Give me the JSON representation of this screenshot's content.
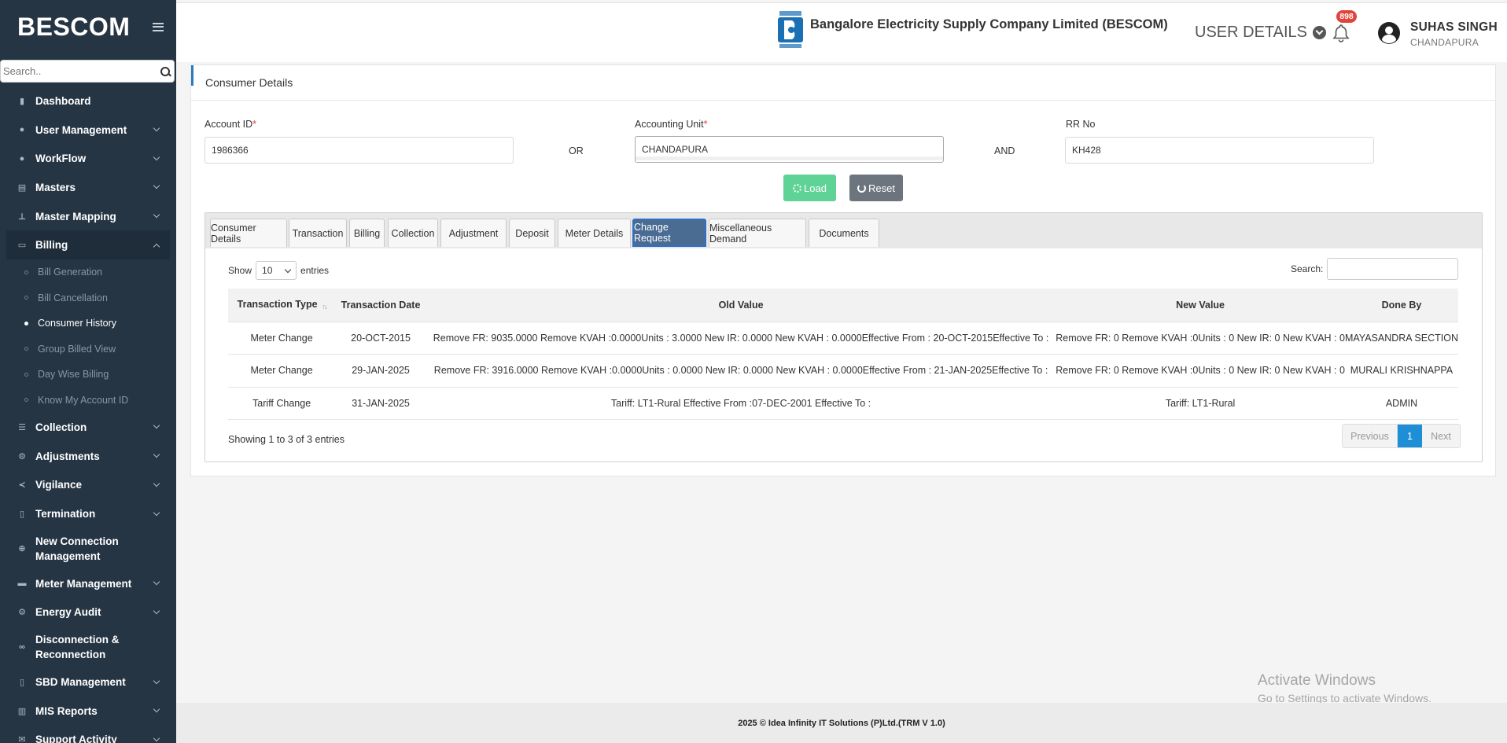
{
  "sidebar": {
    "brand": "BESCOM",
    "search_placeholder": "Search..",
    "items": [
      {
        "label": "Dashboard",
        "icon": "dashboard-icon",
        "glyph": "▮"
      },
      {
        "label": "User Management",
        "icon": "user-icon",
        "glyph": "●"
      },
      {
        "label": "WorkFlow",
        "icon": "workflow-icon",
        "glyph": "●"
      },
      {
        "label": "Masters",
        "icon": "masters-icon",
        "glyph": "▤"
      },
      {
        "label": "Master Mapping",
        "icon": "sitemap-icon",
        "glyph": "⊥"
      },
      {
        "label": "Billing",
        "icon": "monitor-icon",
        "glyph": "▭"
      }
    ],
    "billing_sub": [
      "Bill Generation",
      "Bill Cancellation",
      "Consumer History",
      "Group Billed View",
      "Day Wise Billing",
      "Know My Account ID"
    ],
    "items2": [
      {
        "label": "Collection",
        "icon": "list-icon",
        "glyph": "☰"
      },
      {
        "label": "Adjustments",
        "icon": "adjust-icon",
        "glyph": "⚙"
      },
      {
        "label": "Vigilance",
        "icon": "vk-icon",
        "glyph": "≺"
      },
      {
        "label": "Termination",
        "icon": "trash-icon",
        "glyph": "▯"
      },
      {
        "label": "New Connection Management",
        "icon": "plus-circle-icon",
        "glyph": "⊕"
      },
      {
        "label": "Meter Management",
        "icon": "meter-icon",
        "glyph": "▬"
      },
      {
        "label": "Energy Audit",
        "icon": "cogs-icon",
        "glyph": "⚙"
      },
      {
        "label": "Disconnection & Reconnection",
        "icon": "link-icon",
        "glyph": "∞"
      },
      {
        "label": "SBD Management",
        "icon": "mobile-icon",
        "glyph": "▯"
      },
      {
        "label": "MIS Reports",
        "icon": "bar-chart-icon",
        "glyph": "▥"
      },
      {
        "label": "Support Activity",
        "icon": "support-icon",
        "glyph": "✉"
      }
    ]
  },
  "header": {
    "company": "Bangalore Electricity Supply Company Limited (BESCOM)",
    "user_details": "USER DETAILS",
    "notifications": "898",
    "user_name": "SUHAS SINGH",
    "user_location": "CHANDAPURA"
  },
  "form": {
    "title": "Consumer Details",
    "account_label": "Account ID",
    "account_value": "1986366",
    "or": "OR",
    "unit_label": "Accounting Unit",
    "unit_value": "CHANDAPURA",
    "and": "AND",
    "rr_label": "RR No",
    "rr_value": "KH428",
    "required_mark": "*",
    "load": "Load",
    "reset": "Reset"
  },
  "tabs": [
    "Consumer Details",
    "Transaction",
    "Billing",
    "Collection",
    "Adjustment",
    "Deposit",
    "Meter Details",
    "Change Request",
    "Miscellaneous Demand",
    "Documents"
  ],
  "table": {
    "show": "Show",
    "page_length": "10",
    "entries": "entries",
    "search_label": "Search:",
    "columns": [
      "Transaction Type",
      "Transaction Date",
      "Old Value",
      "New Value",
      "Done By"
    ],
    "rows": [
      [
        "Meter Change",
        "20-OCT-2015",
        "Remove FR: 9035.0000 Remove KVAH :0.0000Units : 3.0000 New IR: 0.0000 New KVAH : 0.0000Effective From : 20-OCT-2015Effective To :",
        "Remove FR: 0 Remove KVAH :0Units : 0 New IR: 0 New KVAH : 0",
        "MAYASANDRA SECTION"
      ],
      [
        "Meter Change",
        "29-JAN-2025",
        "Remove FR: 3916.0000 Remove KVAH :0.0000Units : 0.0000 New IR: 0.0000 New KVAH : 0.0000Effective From : 21-JAN-2025Effective To :",
        "Remove FR: 0 Remove KVAH :0Units : 0 New IR: 0 New KVAH : 0",
        "MURALI KRISHNAPPA"
      ],
      [
        "Tariff Change",
        "31-JAN-2025",
        "Tariff: LT1-Rural Effective From :07-DEC-2001 Effective To :",
        "Tariff: LT1-Rural",
        "ADMIN"
      ]
    ],
    "info": "Showing 1 to 3 of 3 entries",
    "prev": "Previous",
    "page": "1",
    "next": "Next"
  },
  "watermark": {
    "line1": "Activate Windows",
    "line2": "Go to Settings to activate Windows."
  },
  "footer": "2025 © Idea Infinity IT Solutions (P)Ltd.(TRM V 1.0)"
}
